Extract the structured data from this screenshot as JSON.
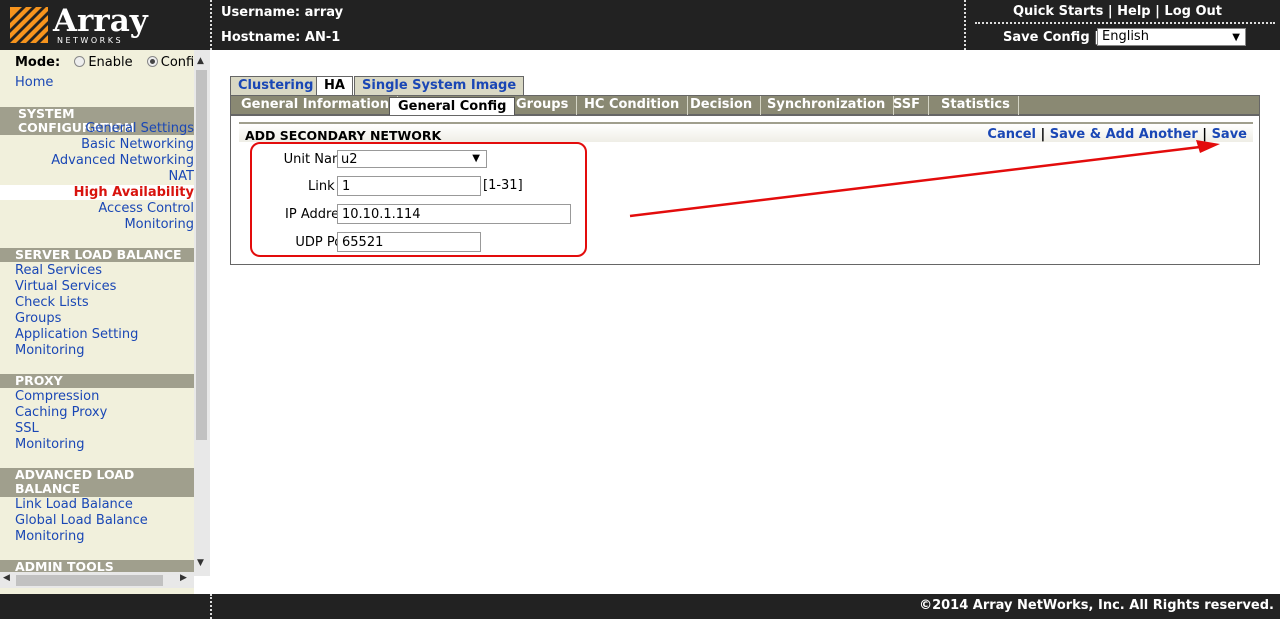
{
  "header": {
    "logo_text": "Array",
    "logo_sub": "NETWORKS",
    "username_label": "Username: array",
    "hostname_label": "Hostname: AN-1",
    "links": [
      "Quick Starts",
      "Help",
      "Log Out"
    ],
    "separator": "|",
    "save_config": "Save Config |",
    "language": "English"
  },
  "sidebar": {
    "mode_label": "Mode:",
    "mode_enable": "Enable",
    "mode_config": "Config",
    "home": "Home",
    "system_config_hdr": "SYSTEM CONFIGURATION",
    "system_items": [
      "General Settings",
      "Basic Networking",
      "Advanced Networking",
      "NAT",
      "High Availability",
      "Access Control",
      "Monitoring"
    ],
    "slb_hdr": "SERVER LOAD BALANCE",
    "slb_items": [
      "Real Services",
      "Virtual Services",
      "Check Lists",
      "Groups",
      "Application Setting",
      "Monitoring"
    ],
    "proxy_hdr": "PROXY",
    "proxy_items": [
      "Compression",
      "Caching Proxy",
      "SSL",
      "Monitoring"
    ],
    "alb_hdr_1": "ADVANCED LOAD",
    "alb_hdr_2": "BALANCE",
    "alb_items": [
      "Link Load Balance",
      "Global Load Balance",
      "Monitoring"
    ],
    "admin_hdr": "ADMIN TOOLS"
  },
  "tabs": {
    "top": [
      "Clustering",
      "HA",
      "Single System Image"
    ],
    "sub": [
      "General Information",
      "General Config",
      "Groups",
      "HC Condition",
      "Decision",
      "Synchronization",
      "SSF",
      "Statistics"
    ]
  },
  "panel": {
    "title": "ADD SECONDARY NETWORK",
    "cancel": "Cancel",
    "save_add_another": "Save & Add Another",
    "save": "Save",
    "sep": "|",
    "unit_name_label": "Unit Name:",
    "unit_name_value": "u2",
    "link_id_label": "Link ID:",
    "link_id_value": "1",
    "link_id_hint": "[1-31]",
    "ip_label": "IP Address:",
    "ip_value": "10.10.1.114",
    "udp_label": "UDP Port:",
    "udp_value": "65521"
  },
  "footer": {
    "copyright": "©2014 Array NetWorks, Inc. All Rights reserved."
  },
  "colors": {
    "accent_link": "#1a47b5",
    "active_red": "#d8130e",
    "annotation_red": "#e30c0c",
    "header_bg": "#222222",
    "sidebar_bg": "#f1f0dc",
    "section_bg": "#a09f8d",
    "subtab_bg": "#8a8973",
    "logo_orange": "#f7941d"
  }
}
